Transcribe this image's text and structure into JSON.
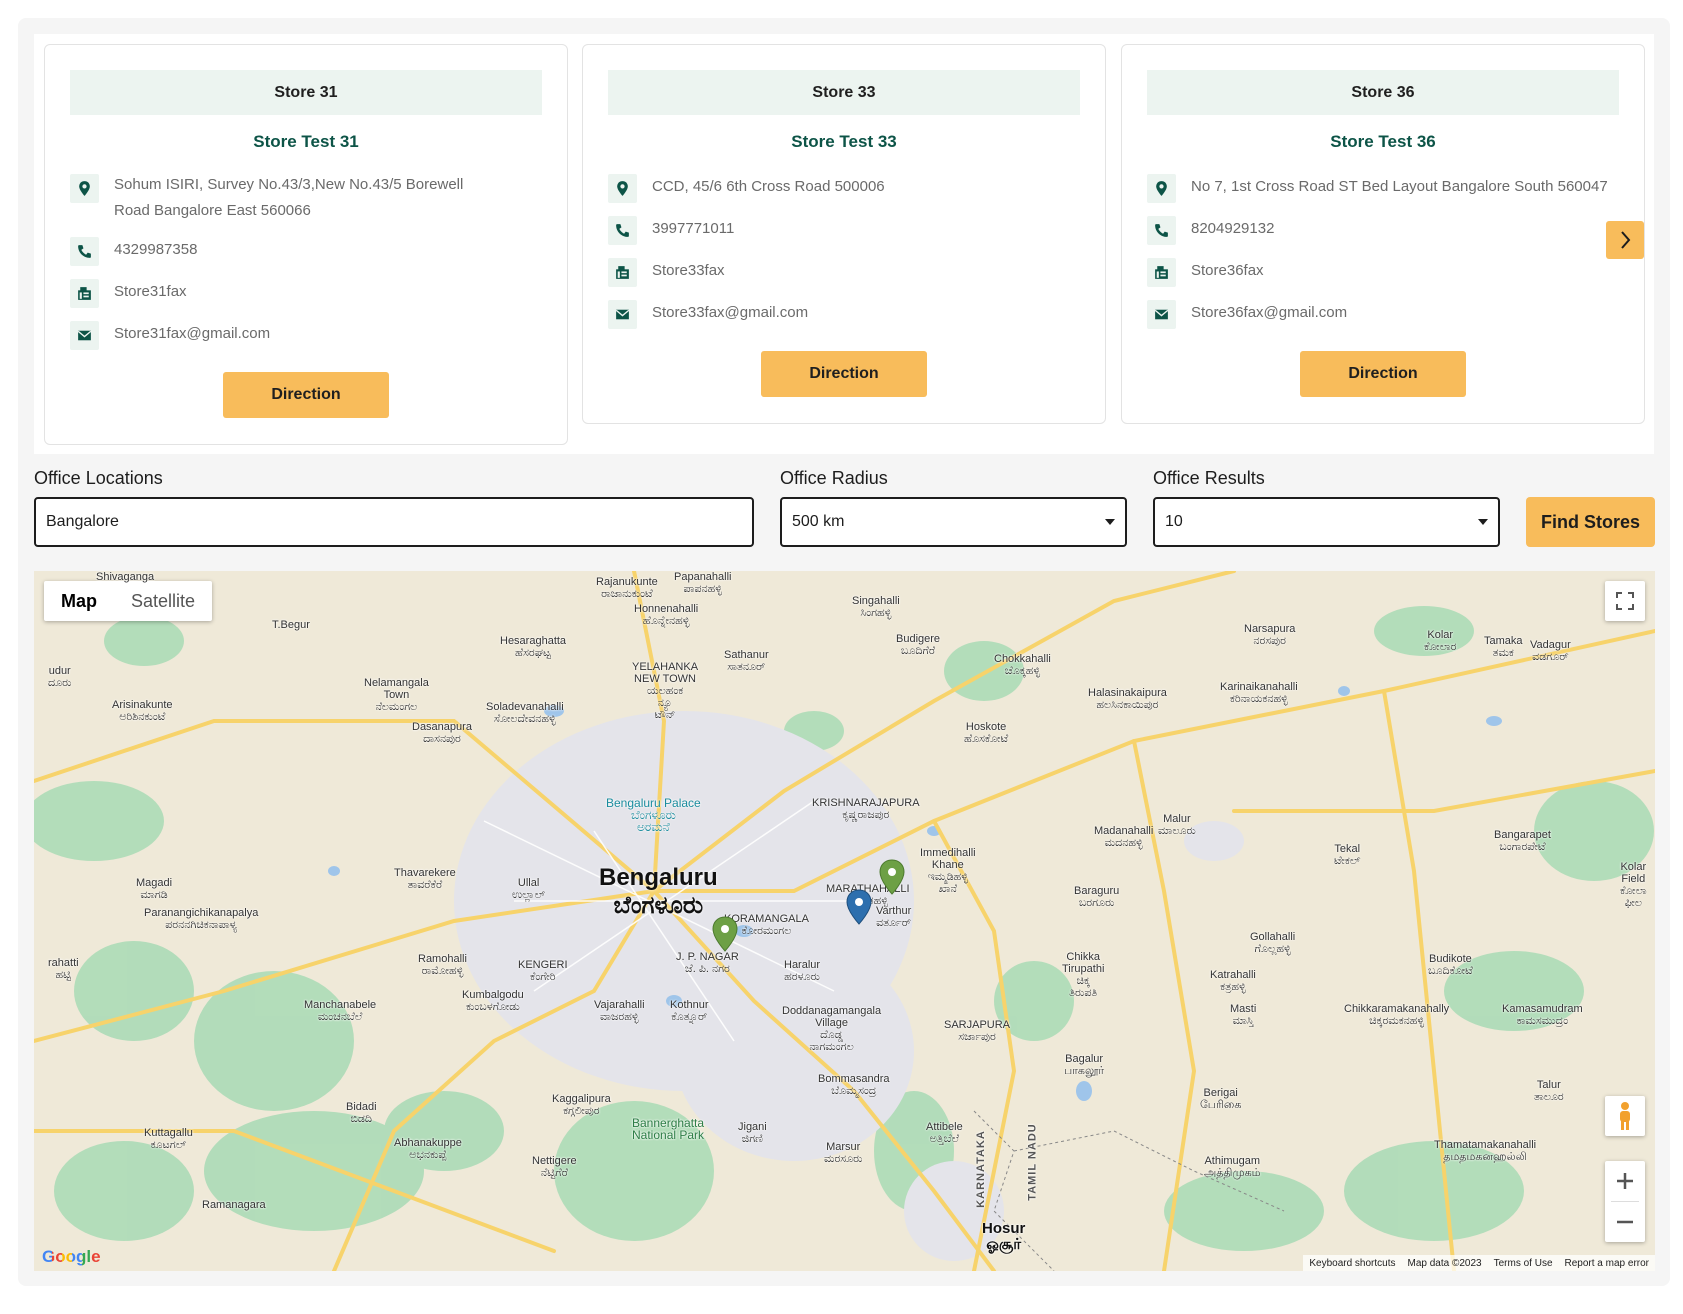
{
  "cards": [
    {
      "header": "Store 31",
      "name": "Store Test 31",
      "address": "Sohum ISIRI, Survey No.43/3,New No.43/5 Borewell Road Bangalore East 560066",
      "phone": "4329987358",
      "fax": "Store31fax",
      "email": "Store31fax@gmail.com",
      "direction_label": "Direction"
    },
    {
      "header": "Store 33",
      "name": "Store Test 33",
      "address": "CCD, 45/6 6th Cross Road 500006",
      "phone": "3997771011",
      "fax": "Store33fax",
      "email": "Store33fax@gmail.com",
      "direction_label": "Direction"
    },
    {
      "header": "Store 36",
      "name": "Store Test 36",
      "address": "No 7, 1st Cross Road ST Bed Layout Bangalore South 560047",
      "phone": "8204929132",
      "fax": "Store36fax",
      "email": "Store36fax@gmail.com",
      "direction_label": "Direction"
    }
  ],
  "carousel": {
    "prev_icon": "chevron-left-icon",
    "next_icon": "chevron-right-icon"
  },
  "form": {
    "location_label": "Office Locations",
    "location_value": "Bangalore",
    "radius_label": "Office Radius",
    "radius_value": "500 km",
    "results_label": "Office Results",
    "results_value": "10",
    "find_label": "Find Stores"
  },
  "map": {
    "type_map": "Map",
    "type_satellite": "Satellite",
    "city_name": "Bengaluru",
    "city_name_local": "ಬೆಂಗಳೂರು",
    "hosur": "Hosur",
    "hosur_local": "ஓசூர்",
    "labels": {
      "shivaganga": "Shivaganga",
      "tbegur": "T.Begur",
      "rajanukunte": "Rajanukunte\nರಾಜಾನುಕುಂಟೆ",
      "papanahalli": "Papanahalli\nಪಾಪನಹಳ್ಳಿ",
      "honnenahalli": "Honnenahalli\nಹೊನ್ನೇನಹಳ್ಳಿ",
      "singhalli": "Singahalli\nಸಿಂಗಹಳ್ಳಿ",
      "hesaraghatta": "Hesaraghatta\nಹೆಸರಘಟ್ಟ",
      "sathanur": "Sathanur\nಸಾತನೂರ್",
      "budigere": "Budigere\nಬೂದಿಗೆರೆ",
      "chokkahalli": "Chokkahalli\nಚೊಕ್ಕಹಳ್ಳಿ",
      "narsapura": "Narsapura\nನರಸಪುರ",
      "kolar": "Kolar\nಕೋಲಾರ",
      "tamaka": "Tamaka\nತಮಕ",
      "vadagur": "Vadagur\nವಡಗೂರ್",
      "nelamangala": "Nelamangala\nTown\nನೆಲಮಂಗಲ",
      "yelahanka": "YELAHANKA\nNEW TOWN\nಯಲಹಂಕ\nನ್ಯೂ\nಟೌನ್",
      "arisinakunte": "Arisinakunte\nಅರಿಶಿನಕುಂಟೆ",
      "soladevanahalli": "Soladevanahalli\nಸೋಲದೇವನಹಳ್ಳಿ",
      "halasinakaipura": "Halasinakaipura\nಹಲಸಿನಕಾಯಿಪುರ",
      "karinaikanahalli": "Karinaikanahalli\nಕರಿನಾಯಕನಹಳ್ಳಿ",
      "dasanapura": "Dasanapura\nದಾಸನಪುರ",
      "hoskote": "Hoskote\nಹೊಸಕೋಟೆ",
      "palace": "Bengaluru Palace\nಬೆಂಗಳೂರು\nಅರಮನೆ",
      "krishnarajapura": "KRISHNARAJAPURA\nಕೃಷ್ಣರಾಜಪುರ",
      "madanahalli": "Madanahalli\nಮದನಹಳ್ಳಿ",
      "malur": "Malur\nಮಾಲೂರು",
      "bangarapet": "Bangarapet\nಬಂಗಾರಪೇಟೆ",
      "tekal": "Tekal\nಟೇಕಲ್",
      "kolar_fields": "Kolar\nField\nಕೋಲಾ\nಫೀಲ",
      "magadi": "Magadi\nಮಾಗಡಿ",
      "thavarekere": "Thavarekere\nತಾವರೆಕೆರೆ",
      "ullal": "Ullal\nಉಲ್ಲಾಲ್",
      "immedihalli": "Immedihalli\nKhane\nಇಮ್ಮಡಿಹಳ್ಳಿ\nಖಾನೆ",
      "marathahalli": "MARATHAHALLI\nಮಾರತಹಳ್ಳಿ",
      "baraguru": "Baraguru\nಬರಗೂರು",
      "paranana": "Paranangichikanapalya\nಪರನನಗಿಚಿಕನಾಪಾಳ್ಯ",
      "koramangala": "KORAMANGALA\nಕೋರಮಂಗಲ",
      "varthur": "Varthur\nವರ್ತೂರ್",
      "gollahalli": "Gollahalli\nಗೊಲ್ಲಹಳ್ಳಿ",
      "budikote": "Budikote\nಬೂದಿಕೋಟೆ",
      "ramohalli": "Ramohalli\nರಾಮೋಹಳ್ಳಿ",
      "kengeri": "KENGERI\nಕೆಂಗೇರಿ",
      "jpnagar": "J. P. NAGAR\nಜೆ. ಪಿ. ನಗರ",
      "haralur": "Haralur\nಹರಳೂರು",
      "chikka": "Chikka\nTirupathi\nಚಿಕ್ಕ\nತಿರುಪತಿ",
      "katrahalli": "Katrahalli\nಕತ್ರಹಳ್ಳಿ",
      "kumbalgodu": "Kumbalgodu\nಕುಂಬಳಗೋಡು",
      "manchanabele": "Manchanabele\nಮಂಚನಬೆಲೆ",
      "vajarahalli": "Vajarahalli\nವಾಜರಹಳ್ಳಿ",
      "kothnur": "Kothnur\nಕೊತ್ನೂರ್",
      "doddanagamangala": "Doddanagamangala\nVillage\nದೊಡ್ಡ\nನಾಗಮಂಗಲ",
      "sarjapura": "SARJAPURA\nಸರ್ಜಾಪುರ",
      "masti": "Masti\nಮಾಸ್ತಿ",
      "chikkaramakanahally": "Chikkaramakanahally\nಚಿಕ್ಕರಮಕನಹಳ್ಳಿ",
      "kamasamudram": "Kamasamudram\nಕಾಮಸಮುದ್ರಂ",
      "bagalur": "Bagalur\nபாகலூர்",
      "bommasandra": "Bommasandra\nಬೊಮ್ಮಸಂದ್ರ",
      "kaggalipura": "Kaggalipura\nಕಗ್ಗಲೀಪುರ",
      "berigai": "Berigai\nபேரிகை",
      "talur": "Talur\nತಾಲೂರ",
      "bidadi": "Bidadi\nಬಿಡದಿ",
      "bannerghatta": "Bannerghatta\nNational Park",
      "jigani": "Jigani\nಜಿಗಣಿ",
      "attibele": "Attibele\nಅತ್ತಿಬೆಲೆ",
      "marsur": "Marsur\nಮರಸೂರು",
      "thamatamakanahalli": "Thamatamakanahalli\nதமதமகனஹல்லி",
      "athimugam": "Athimugam\nஅத்திமுகம்",
      "kuttagallu": "Kuttagallu\nಕೂಟಗಲ್",
      "abhanakuppe": "Abhanakuppe\nಅಭನಕುಪ್ಪೆ",
      "nettigere": "Nettigere\nನೆಟ್ಟಿಗೆರೆ",
      "ramanagara": "Ramanagara",
      "karnataka": "KARNATAKA",
      "tamilnadu": "TAMIL NADU",
      "udur": "udur\nದೂರು",
      "rahatti": "rahatti\nಹಟ್ಟಿ"
    },
    "attribution": {
      "shortcuts": "Keyboard shortcuts",
      "data": "Map data ©2023",
      "terms": "Terms of Use",
      "report": "Report a map error"
    },
    "google": "Google",
    "icons": [
      "fullscreen-icon",
      "pegman-icon",
      "zoom-in-icon",
      "zoom-out-icon",
      "map-pin-icon"
    ]
  },
  "colors": {
    "accent": "#f8bc5b",
    "brand_green": "#0d5447",
    "icon_bg": "#ecf4f0",
    "pin_green": "#6da045",
    "pin_blue": "#2d6fae",
    "park_green": "#a8dab5",
    "road_yellow": "#f7d36b"
  }
}
